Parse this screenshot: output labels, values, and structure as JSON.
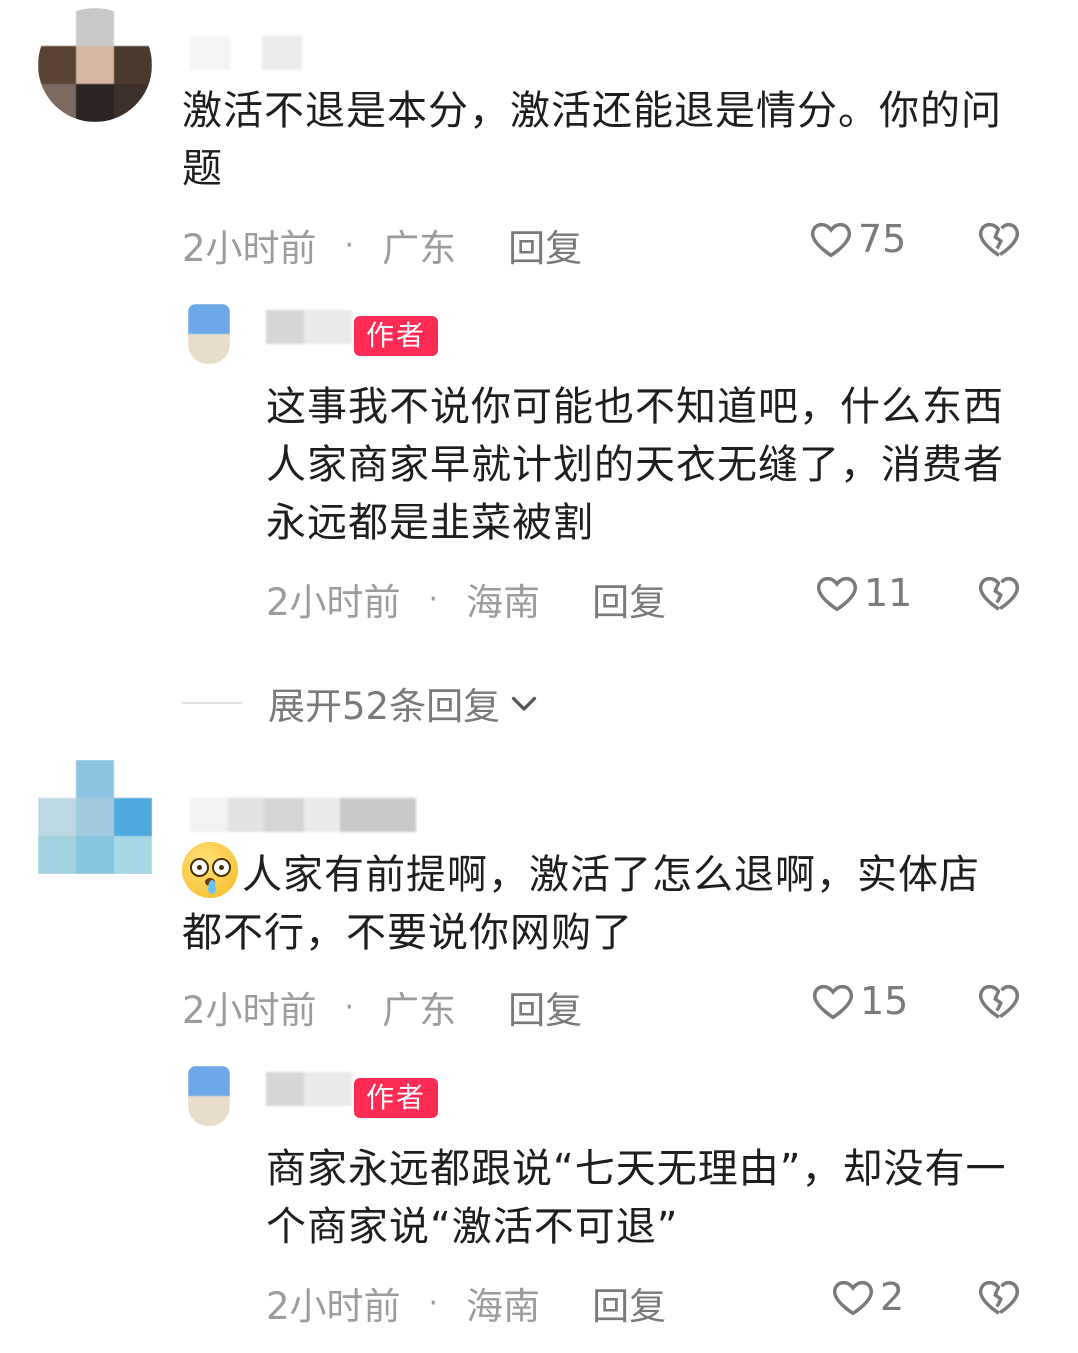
{
  "comments": [
    {
      "text": "激活不退是本分，激活还能退是情分。你的问题",
      "time": "2小时前",
      "location": "广东",
      "reply_label": "回复",
      "likes": "75",
      "reply": {
        "badge": "作者",
        "text": "这事我不说你可能也不知道吧，什么东西人家商家早就计划的天衣无缝了，消费者永远都是韭菜被割",
        "time": "2小时前",
        "location": "海南",
        "reply_label": "回复",
        "likes": "11"
      },
      "expand_label": "展开52条回复"
    },
    {
      "text": "人家有前提啊，激活了怎么退啊，实体店都不行，不要说你网购了",
      "time": "2小时前",
      "location": "广东",
      "reply_label": "回复",
      "likes": "15",
      "reply": {
        "badge": "作者",
        "text": "商家永远都跟说“七天无理由”，却没有一个商家说“激活不可退”",
        "time": "2小时前",
        "location": "海南",
        "reply_label": "回复",
        "likes": "2"
      }
    }
  ],
  "meta_separator": "·",
  "icons": {
    "like": "heart-outline-icon",
    "dislike": "broken-heart-icon",
    "expand": "chevron-down-icon",
    "emoji": "dizzy-drooling-face-emoji"
  },
  "colors": {
    "author_badge": "#fe2c55",
    "meta_text": "#9c9c9c",
    "body_text": "#1e1e1e"
  }
}
